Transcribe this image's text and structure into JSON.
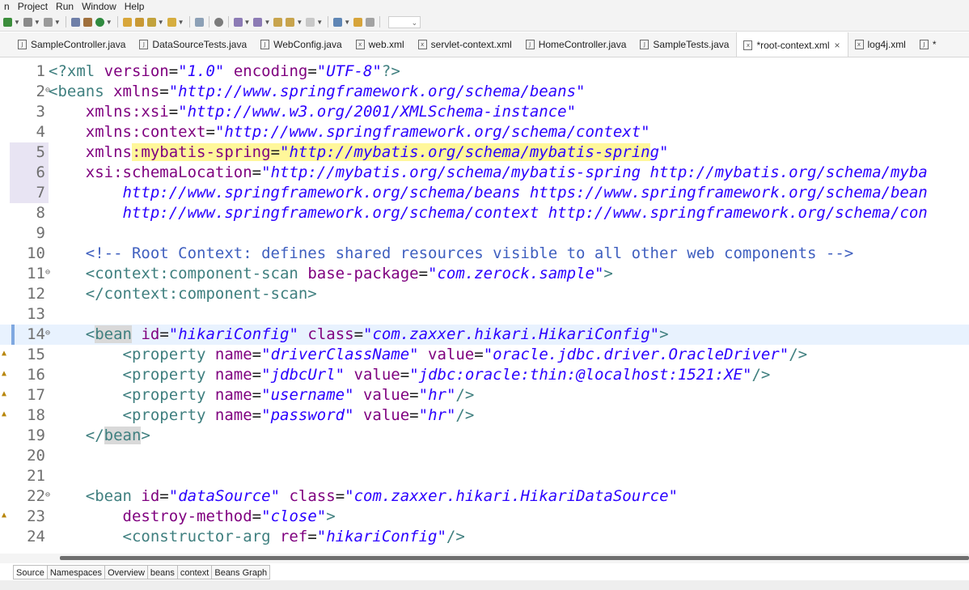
{
  "menu": [
    "n",
    "Project",
    "Run",
    "Window",
    "Help"
  ],
  "toolbar": {
    "combo_value": "⌄"
  },
  "tabs": [
    {
      "label": "SampleController.java",
      "icon": "J",
      "active": false
    },
    {
      "label": "DataSourceTests.java",
      "icon": "J",
      "active": false
    },
    {
      "label": "WebConfig.java",
      "icon": "J",
      "active": false
    },
    {
      "label": "web.xml",
      "icon": "x",
      "active": false
    },
    {
      "label": "servlet-context.xml",
      "icon": "x",
      "active": false
    },
    {
      "label": "HomeController.java",
      "icon": "J",
      "active": false
    },
    {
      "label": "SampleTests.java",
      "icon": "J",
      "active": false
    },
    {
      "label": "*root-context.xml",
      "icon": "x",
      "active": true
    },
    {
      "label": "log4j.xml",
      "icon": "x",
      "active": false
    },
    {
      "label": "*",
      "icon": "J",
      "active": false
    }
  ],
  "editor": {
    "lines": [
      {
        "n": "1",
        "segs": [
          [
            "pi",
            "<?xml "
          ],
          [
            "attr",
            "version"
          ],
          [
            "txt",
            "="
          ],
          [
            "str",
            "\"1.0\""
          ],
          [
            "txt",
            " "
          ],
          [
            "attr",
            "encoding"
          ],
          [
            "txt",
            "="
          ],
          [
            "str",
            "\"UTF-8\""
          ],
          [
            "pi",
            "?>"
          ]
        ]
      },
      {
        "n": "2",
        "fold": true,
        "segs": [
          [
            "tag",
            "<beans "
          ],
          [
            "attr",
            "xmlns"
          ],
          [
            "txt",
            "="
          ],
          [
            "str",
            "\"http://www.springframework.org/schema/beans\""
          ]
        ]
      },
      {
        "n": "3",
        "segs": [
          [
            "txt",
            "    "
          ],
          [
            "attr",
            "xmlns:xsi"
          ],
          [
            "txt",
            "="
          ],
          [
            "str",
            "\"http://www.w3.org/2001/XMLSchema-instance\""
          ]
        ]
      },
      {
        "n": "4",
        "segs": [
          [
            "txt",
            "    "
          ],
          [
            "attr",
            "xmlns:context"
          ],
          [
            "txt",
            "="
          ],
          [
            "str",
            "\"http://www.springframework.org/schema/context\""
          ]
        ]
      },
      {
        "n": "5",
        "rowhl": true,
        "segs": [
          [
            "txt",
            "    "
          ],
          [
            "attr",
            "xmlns"
          ],
          [
            "attrhl",
            ":mybatis-spring"
          ],
          [
            "txthl",
            "="
          ],
          [
            "strhl",
            "\"http://mybatis.org/schema/mybatis-sprin"
          ],
          [
            "str",
            "g\""
          ]
        ]
      },
      {
        "n": "6",
        "rowhl": true,
        "segs": [
          [
            "txt",
            "    "
          ],
          [
            "attr",
            "xsi:schemaLocation"
          ],
          [
            "txt",
            "="
          ],
          [
            "str",
            "\"http://mybatis.org/schema/mybatis-spring http://mybatis.org/schema/myba"
          ]
        ]
      },
      {
        "n": "7",
        "rowhl": true,
        "segs": [
          [
            "str",
            "        http://www.springframework.org/schema/beans https://www.springframework.org/schema/bean"
          ]
        ]
      },
      {
        "n": "8",
        "segs": [
          [
            "str",
            "        http://www.springframework.org/schema/context http://www.springframework.org/schema/con"
          ]
        ]
      },
      {
        "n": "9",
        "segs": []
      },
      {
        "n": "10",
        "segs": [
          [
            "txt",
            "    "
          ],
          [
            "com",
            "<!-- Root Context: defines shared resources visible to all other web components -->"
          ]
        ]
      },
      {
        "n": "11",
        "fold": true,
        "segs": [
          [
            "txt",
            "    "
          ],
          [
            "tag",
            "<context:component-scan "
          ],
          [
            "attr",
            "base-package"
          ],
          [
            "txt",
            "="
          ],
          [
            "str",
            "\"com.zerock.sample\""
          ],
          [
            "tag",
            ">"
          ]
        ]
      },
      {
        "n": "12",
        "segs": [
          [
            "txt",
            "    "
          ],
          [
            "tag",
            "</context:component-scan>"
          ]
        ]
      },
      {
        "n": "13",
        "segs": []
      },
      {
        "n": "14",
        "fold": true,
        "current": true,
        "segs": [
          [
            "txt",
            "    "
          ],
          [
            "tag",
            "<"
          ],
          [
            "tagocc",
            "bean"
          ],
          [
            "tag",
            " "
          ],
          [
            "attr",
            "id"
          ],
          [
            "txt",
            "="
          ],
          [
            "str",
            "\"hikariConfig\""
          ],
          [
            "txt",
            " "
          ],
          [
            "attr",
            "class"
          ],
          [
            "txt",
            "="
          ],
          [
            "str",
            "\"com.zaxxer.hikari.HikariConfig\""
          ],
          [
            "tag",
            ">"
          ]
        ]
      },
      {
        "n": "15",
        "warn": true,
        "segs": [
          [
            "txt",
            "        "
          ],
          [
            "tag",
            "<property "
          ],
          [
            "attr",
            "name"
          ],
          [
            "txt",
            "="
          ],
          [
            "str",
            "\"driverClassName\""
          ],
          [
            "txt",
            " "
          ],
          [
            "attr",
            "value"
          ],
          [
            "txt",
            "="
          ],
          [
            "str",
            "\"oracle.jdbc.driver.OracleDriver\""
          ],
          [
            "tag",
            "/>"
          ]
        ]
      },
      {
        "n": "16",
        "warn": true,
        "segs": [
          [
            "txt",
            "        "
          ],
          [
            "tag",
            "<property "
          ],
          [
            "attr",
            "name"
          ],
          [
            "txt",
            "="
          ],
          [
            "str",
            "\"jdbcUrl\""
          ],
          [
            "txt",
            " "
          ],
          [
            "attr",
            "value"
          ],
          [
            "txt",
            "="
          ],
          [
            "str",
            "\"jdbc:oracle:thin:@localhost:1521:XE\""
          ],
          [
            "tag",
            "/>"
          ]
        ]
      },
      {
        "n": "17",
        "warn": true,
        "segs": [
          [
            "txt",
            "        "
          ],
          [
            "tag",
            "<property "
          ],
          [
            "attr",
            "name"
          ],
          [
            "txt",
            "="
          ],
          [
            "str",
            "\"username\""
          ],
          [
            "txt",
            " "
          ],
          [
            "attr",
            "value"
          ],
          [
            "txt",
            "="
          ],
          [
            "str",
            "\"hr\""
          ],
          [
            "tag",
            "/>"
          ]
        ]
      },
      {
        "n": "18",
        "warn": true,
        "segs": [
          [
            "txt",
            "        "
          ],
          [
            "tag",
            "<property "
          ],
          [
            "attr",
            "name"
          ],
          [
            "txt",
            "="
          ],
          [
            "str",
            "\"password\""
          ],
          [
            "txt",
            " "
          ],
          [
            "attr",
            "value"
          ],
          [
            "txt",
            "="
          ],
          [
            "str",
            "\"hr\""
          ],
          [
            "tag",
            "/>"
          ]
        ]
      },
      {
        "n": "19",
        "segs": [
          [
            "txt",
            "    "
          ],
          [
            "tag",
            "</"
          ],
          [
            "tagocc",
            "bean"
          ],
          [
            "tag",
            ">"
          ]
        ]
      },
      {
        "n": "20",
        "segs": []
      },
      {
        "n": "21",
        "segs": []
      },
      {
        "n": "22",
        "fold": true,
        "segs": [
          [
            "txt",
            "    "
          ],
          [
            "tag",
            "<bean "
          ],
          [
            "attr",
            "id"
          ],
          [
            "txt",
            "="
          ],
          [
            "str",
            "\"dataSource\""
          ],
          [
            "txt",
            " "
          ],
          [
            "attr",
            "class"
          ],
          [
            "txt",
            "="
          ],
          [
            "str",
            "\"com.zaxxer.hikari.HikariDataSource\""
          ]
        ]
      },
      {
        "n": "23",
        "warn": true,
        "segs": [
          [
            "txt",
            "        "
          ],
          [
            "attr",
            "destroy-method"
          ],
          [
            "txt",
            "="
          ],
          [
            "str",
            "\"close\""
          ],
          [
            "tag",
            ">"
          ]
        ]
      },
      {
        "n": "24",
        "segs": [
          [
            "txt",
            "        "
          ],
          [
            "tag",
            "<constructor-arg "
          ],
          [
            "attr",
            "ref"
          ],
          [
            "txt",
            "="
          ],
          [
            "str",
            "\"hikariConfig\""
          ],
          [
            "tag",
            "/>"
          ]
        ]
      }
    ]
  },
  "bottom_tabs": [
    "Source",
    "Namespaces",
    "Overview",
    "beans",
    "context",
    "Beans Graph"
  ]
}
